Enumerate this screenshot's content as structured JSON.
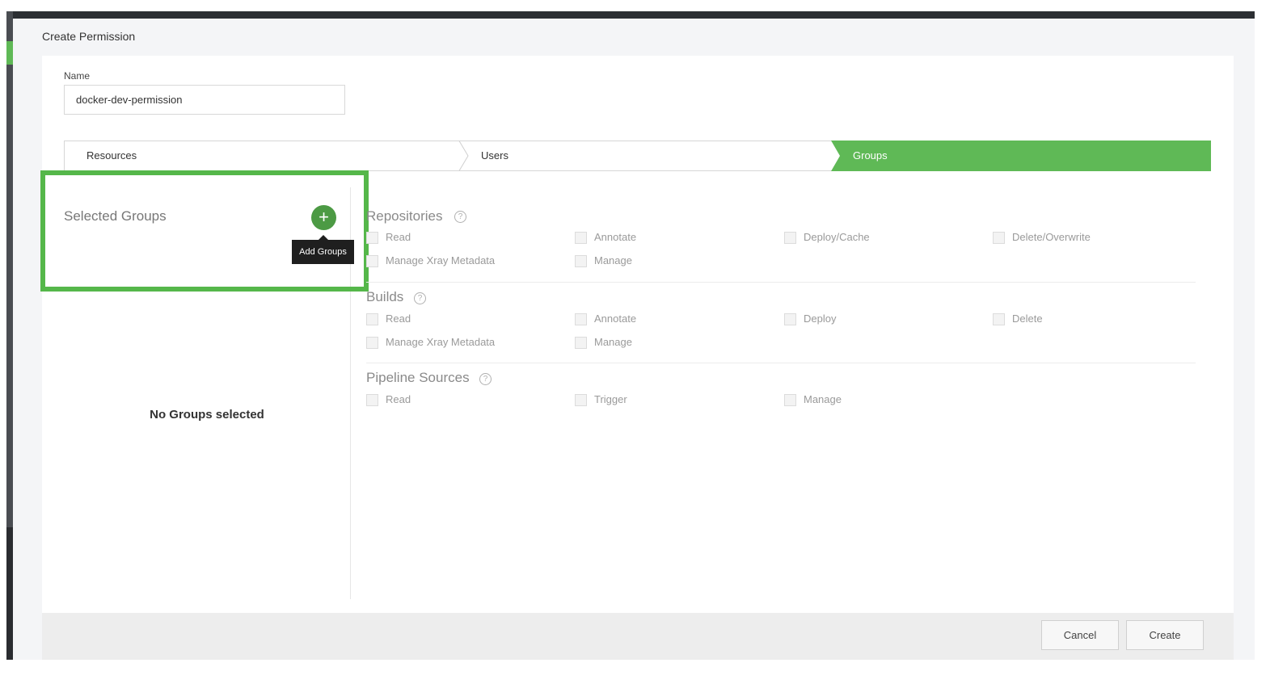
{
  "page": {
    "title": "Create Permission"
  },
  "form": {
    "name_label": "Name",
    "name_value": "docker-dev-permission"
  },
  "steps": [
    {
      "label": "Resources",
      "active": false
    },
    {
      "label": "Users",
      "active": false
    },
    {
      "label": "Groups",
      "active": true
    }
  ],
  "groups_panel": {
    "title": "Selected Groups",
    "add_tooltip": "Add Groups",
    "empty_text": "No Groups selected"
  },
  "permissions": {
    "repositories": {
      "title": "Repositories",
      "items": [
        "Read",
        "Annotate",
        "Deploy/Cache",
        "Delete/Overwrite",
        "Manage Xray Metadata",
        "Manage"
      ]
    },
    "builds": {
      "title": "Builds",
      "items": [
        "Read",
        "Annotate",
        "Deploy",
        "Delete",
        "Manage Xray Metadata",
        "Manage"
      ]
    },
    "pipeline_sources": {
      "title": "Pipeline Sources",
      "items": [
        "Read",
        "Trigger",
        "Manage"
      ]
    }
  },
  "footer": {
    "cancel_label": "Cancel",
    "create_label": "Create"
  },
  "colors": {
    "accent_green": "#5fb956",
    "add_button_green": "#4c9a44",
    "highlight_green": "#55b74a"
  },
  "icons": {
    "add": "plus-icon",
    "help": "question-circle-icon"
  }
}
